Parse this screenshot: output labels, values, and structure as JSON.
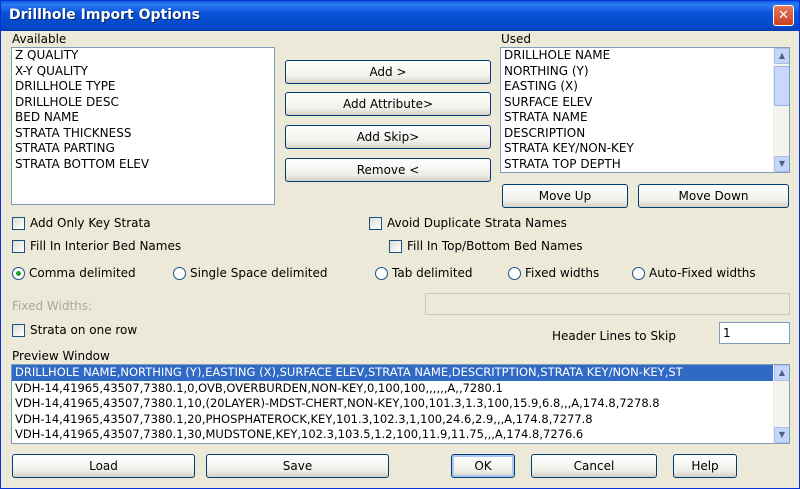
{
  "window": {
    "title": "Drillhole Import Options",
    "close_symbol": "✕"
  },
  "available": {
    "label": "Available",
    "items": [
      "Z QUALITY",
      "X-Y QUALITY",
      "DRILLHOLE TYPE",
      "DRILLHOLE DESC",
      "BED NAME",
      "STRATA THICKNESS",
      "STRATA PARTING",
      "STRATA BOTTOM ELEV"
    ]
  },
  "used": {
    "label": "Used",
    "items": [
      "DRILLHOLE NAME",
      "NORTHING (Y)",
      "EASTING (X)",
      "SURFACE ELEV",
      "STRATA NAME",
      "DESCRIPTION",
      "STRATA KEY/NON-KEY",
      "STRATA TOP DEPTH"
    ]
  },
  "middle_buttons": {
    "add": "Add >",
    "add_attribute": "Add Attribute>",
    "add_skip": "Add Skip>",
    "remove": "Remove <"
  },
  "order_buttons": {
    "move_up": "Move Up",
    "move_down": "Move Down"
  },
  "checkboxes": {
    "add_only_key_strata": "Add Only Key Strata",
    "avoid_duplicate": "Avoid Duplicate Strata Names",
    "fill_interior": "Fill In Interior Bed Names",
    "fill_top_bottom": "Fill In Top/Bottom Bed Names",
    "strata_one_row": "Strata on one row"
  },
  "delimiters": {
    "selected": "Comma delimited",
    "comma": "Comma delimited",
    "single_space": "Single Space delimited",
    "tab": "Tab delimited",
    "fixed": "Fixed widths",
    "auto_fixed": "Auto-Fixed widths"
  },
  "fixed_widths": {
    "label": "Fixed Widths:",
    "value": ""
  },
  "header_lines": {
    "label": "Header Lines to Skip",
    "value": "1"
  },
  "preview": {
    "label": "Preview Window",
    "lines": [
      "DRILLHOLE NAME,NORTHING (Y),EASTING (X),SURFACE ELEV,STRATA NAME,DESCRITPTION,STRATA KEY/NON-KEY,ST",
      "VDH-14,41965,43507,7380.1,0,OVB,OVERBURDEN,NON-KEY,0,100,100,,,,,,A,,7280.1",
      "VDH-14,41965,43507,7380.1,10,(20LAYER)-MDST-CHERT,NON-KEY,100,101.3,1.3,100,15.9,6.8,,,A,174.8,7278.8",
      "VDH-14,41965,43507,7380.1,20,PHOSPHATEROCK,KEY,101.3,102.3,1,100,24.6,2.9,,,A,174.8,7277.8",
      "VDH-14,41965,43507,7380.1,30,MUDSTONE,KEY,102.3,103.5,1.2,100,11.9,11.75,,,A,174.8,7276.6"
    ]
  },
  "bottom_buttons": {
    "load": "Load",
    "save": "Save",
    "ok": "OK",
    "cancel": "Cancel",
    "help": "Help"
  }
}
